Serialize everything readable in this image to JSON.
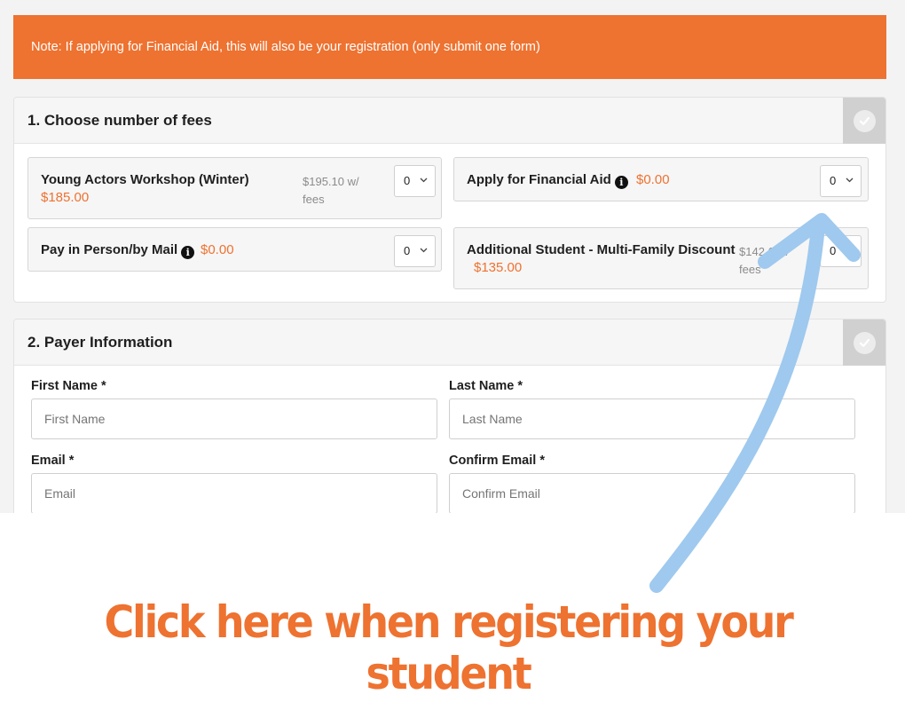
{
  "banner": {
    "note": "Note: If applying for Financial Aid, this will also be your registration (only submit one form)"
  },
  "section1": {
    "title": "1. Choose number of fees",
    "fees": [
      {
        "name": "Young Actors Workshop (Winter)",
        "price": "$185.00",
        "alt_price": "$195.10 w/ fees",
        "qty": "0"
      },
      {
        "name": "Apply for Financial Aid",
        "price": "$0.00",
        "qty": "0"
      },
      {
        "name": "Pay in Person/by Mail",
        "price": "$0.00",
        "qty": "0"
      },
      {
        "name": "Additional Student - Multi-Family Discount",
        "price": "$135.00",
        "alt_price": "$142.6 w/ fees",
        "qty": "0"
      }
    ]
  },
  "section2": {
    "title": "2. Payer Information",
    "fields": {
      "first_name": {
        "label": "First Name *",
        "placeholder": "First Name"
      },
      "last_name": {
        "label": "Last Name *",
        "placeholder": "Last Name"
      },
      "email": {
        "label": "Email *",
        "placeholder": "Email"
      },
      "confirm_email": {
        "label": "Confirm Email *",
        "placeholder": "Confirm Email"
      }
    }
  },
  "annotation": {
    "cta": "Click here when registering your student"
  },
  "colors": {
    "accent": "#ee7230",
    "arrow": "#9fc9ee"
  }
}
